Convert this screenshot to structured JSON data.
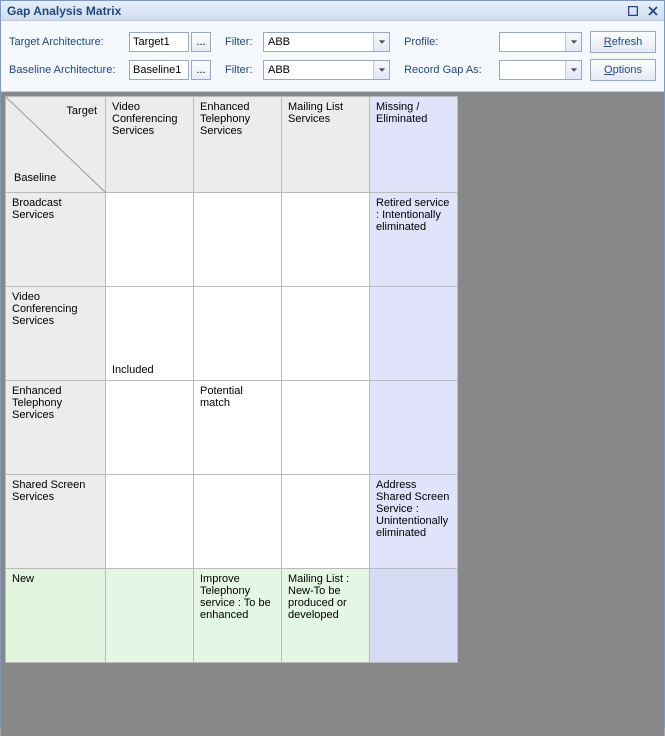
{
  "window": {
    "title": "Gap Analysis Matrix"
  },
  "toolbar": {
    "target_label": "Target Architecture:",
    "target_value": "Target1",
    "baseline_label": "Baseline Architecture:",
    "baseline_value": "Baseline1",
    "filter_label": "Filter:",
    "filter_value_top": "ABB",
    "filter_value_bottom": "ABB",
    "profile_label": "Profile:",
    "profile_value": "",
    "recordgap_label": "Record Gap As:",
    "recordgap_value": "",
    "refresh_label": "Refresh",
    "options_label": "Options",
    "ellipsis": "..."
  },
  "matrix": {
    "corner_target": "Target",
    "corner_baseline": "Baseline",
    "cols": [
      "Video Conferencing Services",
      "Enhanced Telephony Services",
      "Mailing List Services",
      "Missing / Eliminated"
    ],
    "rows": [
      "Broadcast Services",
      "Video Conferencing Services",
      "Enhanced Telephony Services",
      "Shared Screen Services",
      "New"
    ],
    "cells": {
      "r0c3": "Retired service : Intentionally eliminated",
      "r1c0": "Included",
      "r2c1": "Potential match",
      "r3c3": "Address Shared Screen Service : Unintentionally eliminated",
      "r4c1": "Improve Telephony service : To be enhanced",
      "r4c2": "Mailing List : New-To be produced or developed"
    }
  }
}
